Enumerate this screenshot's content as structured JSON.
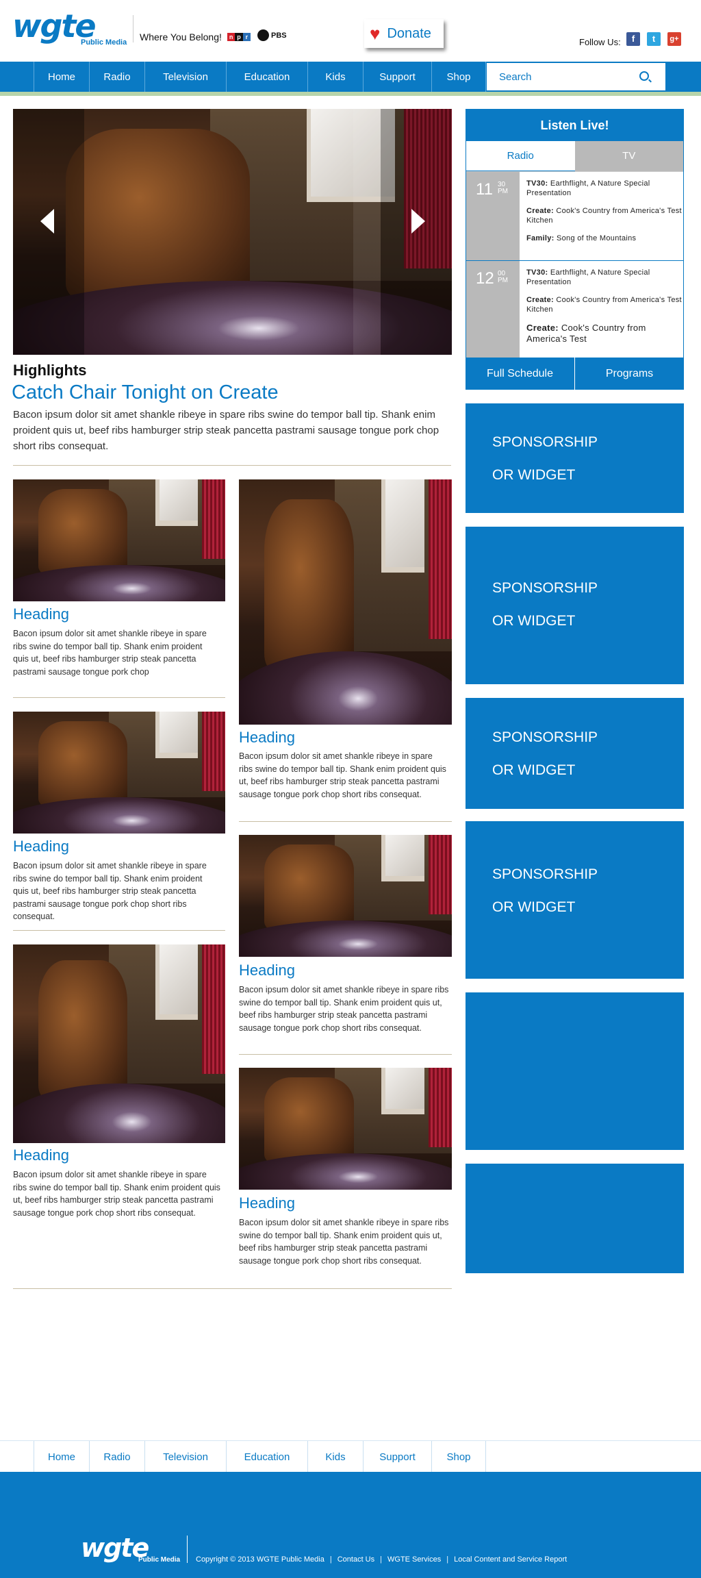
{
  "header": {
    "logo_text": "wgte",
    "logo_sub": "Public Media",
    "tagline": "Where You Belong!",
    "npr_letters": [
      "n",
      "p",
      "r"
    ],
    "pbs_label": "PBS",
    "donate_label": "Donate",
    "follow_label": "Follow Us:",
    "social": [
      {
        "name": "facebook-icon",
        "glyph": "f",
        "color": "#3b5998"
      },
      {
        "name": "twitter-icon",
        "glyph": "t",
        "color": "#2ea6e0"
      },
      {
        "name": "google-plus-icon",
        "glyph": "g+",
        "color": "#d9412f"
      }
    ]
  },
  "nav": {
    "items": [
      "Home",
      "Radio",
      "Television",
      "Education",
      "Kids",
      "Support",
      "Shop"
    ],
    "search_placeholder": "Search"
  },
  "highlights": {
    "label": "Highlights",
    "title": "Catch Chair Tonight on Create",
    "text": "Bacon ipsum dolor sit amet shankle ribeye in spare ribs swine do tempor ball tip. Shank enim proident quis ut, beef ribs hamburger strip steak pancetta pastrami sausage tongue pork chop short ribs consequat."
  },
  "cards_left": [
    {
      "heading": "Heading",
      "text": "Bacon ipsum dolor sit amet shankle ribeye in spare ribs swine do tempor ball tip. Shank enim proident quis ut, beef ribs hamburger strip steak pancetta pastrami sausage tongue pork chop"
    },
    {
      "heading": "Heading",
      "text": "Bacon ipsum dolor sit amet shankle ribeye in spare ribs swine do tempor ball tip. Shank enim proident quis ut, beef ribs hamburger strip steak pancetta pastrami sausage tongue pork chop short ribs consequat."
    },
    {
      "heading": "Heading",
      "text": "Bacon ipsum dolor sit amet shankle ribeye in spare ribs swine do tempor ball tip. Shank enim proident quis ut, beef ribs hamburger strip steak pancetta pastrami sausage tongue pork chop short ribs consequat."
    }
  ],
  "cards_right": [
    {
      "heading": "Heading",
      "text": "Bacon ipsum dolor sit amet shankle ribeye in spare ribs swine do tempor ball tip. Shank enim proident quis ut, beef ribs hamburger strip steak pancetta pastrami sausage tongue pork chop short ribs consequat."
    },
    {
      "heading": "Heading",
      "text": "Bacon ipsum dolor sit amet shankle ribeye in spare ribs swine do tempor ball tip. Shank enim proident quis ut, beef ribs hamburger strip steak pancetta pastrami sausage tongue pork chop short ribs consequat."
    },
    {
      "heading": "Heading",
      "text": "Bacon ipsum dolor sit amet shankle ribeye in spare ribs swine do tempor ball tip. Shank enim proident quis ut, beef ribs hamburger strip steak pancetta pastrami sausage tongue pork chop short ribs consequat."
    }
  ],
  "listen": {
    "title": "Listen Live!",
    "tab_radio": "Radio",
    "tab_tv": "TV",
    "slots": [
      {
        "hour": "11",
        "min": "30",
        "ampm": "PM",
        "programs": [
          {
            "channel": "TV30:",
            "title": " Earthflight, A Nature Special Presentation"
          },
          {
            "channel": "Create:",
            "title": " Cook's Country from America's Test Kitchen"
          },
          {
            "channel": "Family:",
            "title": " Song of the Mountains"
          }
        ]
      },
      {
        "hour": "12",
        "min": "00",
        "ampm": "PM",
        "programs": [
          {
            "channel": "TV30:",
            "title": " Earthflight, A Nature Special Presentation"
          },
          {
            "channel": "Create:",
            "title": " Cook's Country from America's Test Kitchen"
          },
          {
            "channel": "Create:",
            "title": " Cook's Country from America's Test"
          }
        ]
      }
    ],
    "btn_schedule": "Full Schedule",
    "btn_programs": "Programs"
  },
  "widgets": [
    "SPONSORSHIP OR WIDGET",
    "SPONSORSHIP OR WIDGET",
    "SPONSORSHIP OR WIDGET",
    "SPONSORSHIP OR WIDGET",
    "",
    ""
  ],
  "footer": {
    "nav_items": [
      "Home",
      "Radio",
      "Television",
      "Education",
      "Kids",
      "Support",
      "Shop"
    ],
    "logo_text": "wgte",
    "logo_sub": "Public Media",
    "copyright": "Copyright © 2013 WGTE Public Media",
    "links": [
      "Contact Us",
      "WGTE Services",
      "Local Content and Service Report"
    ]
  },
  "colors": {
    "accent": "#0a7ac4",
    "rule": "#c8bea4"
  }
}
